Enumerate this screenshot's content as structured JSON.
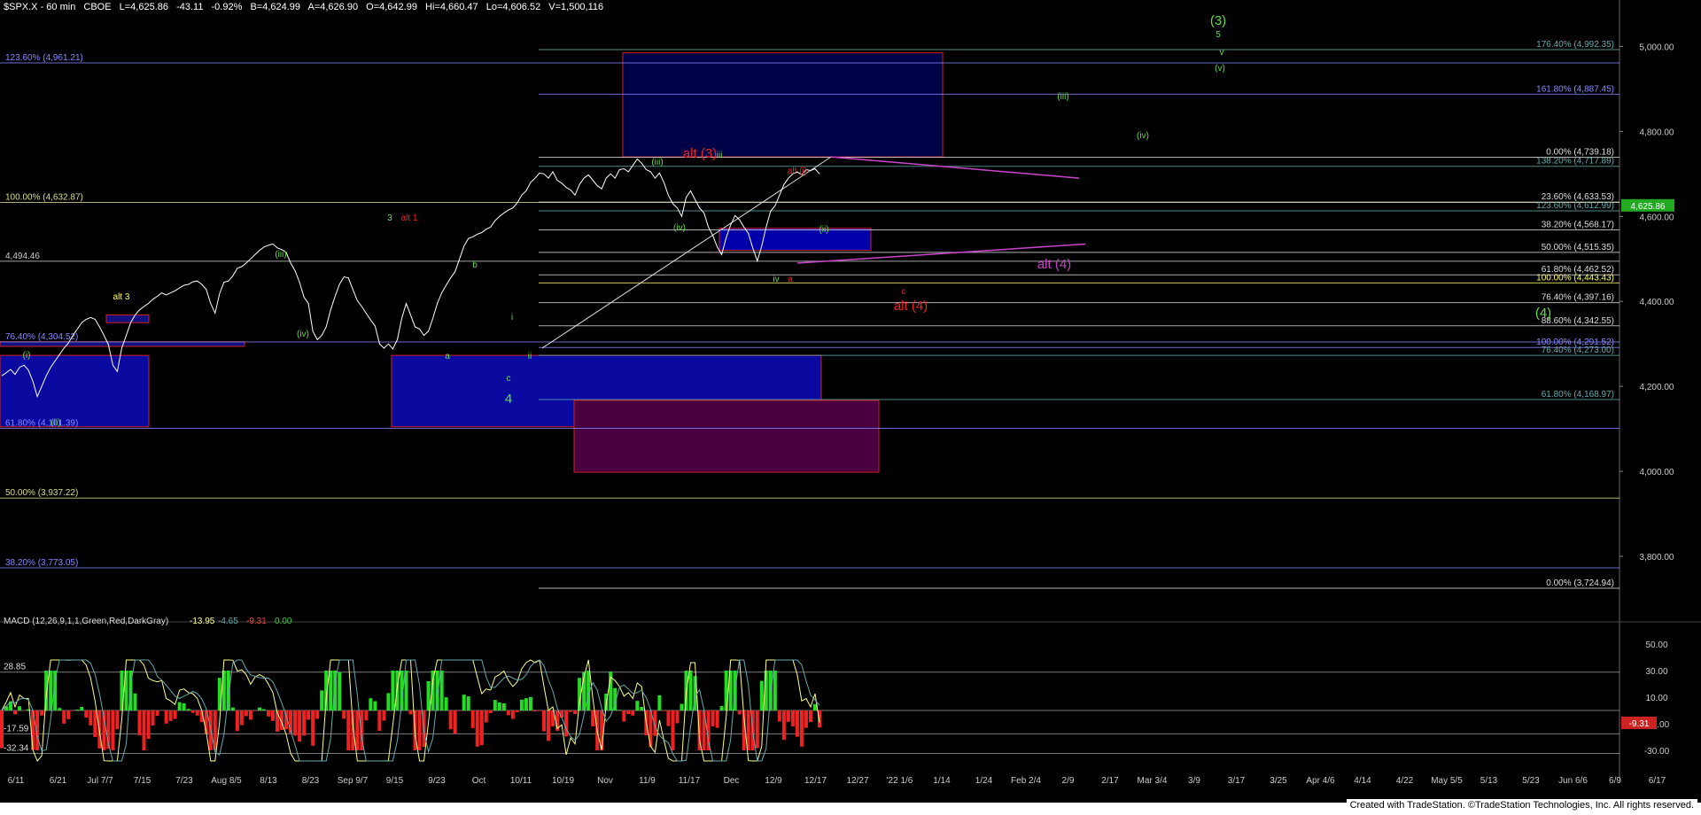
{
  "header": {
    "symbol": "$SPX.X - 60 min",
    "exchange": "CBOE",
    "last": "L=4,625.86",
    "change": "-43.11",
    "change_pct": "-0.92%",
    "bid": "B=4,624.99",
    "ask": "A=4,626.90",
    "open": "O=4,642.99",
    "high": "Hi=4,660.47",
    "low": "Lo=4,606.52",
    "volume": "V=1,500,116"
  },
  "credit": "Created with TradeStation. ©TradeStation Technologies, Inc. All rights reserved.",
  "colors": {
    "background": "#000000",
    "price": "#ffffff",
    "green_count": "#66dd44",
    "red_count": "#ee2222",
    "magenta_count": "#cc44cc",
    "blue_zone": "#0a0a80",
    "fib_line": "#b0b060"
  },
  "chart_data": [
    {
      "type": "line",
      "name": "price",
      "ylim": [
        3650,
        5080
      ],
      "y_ticks": [
        "5,000.00",
        "4,800.00",
        "4,600.00",
        "4,400.00",
        "4,200.00",
        "4,000.00",
        "3,800.00"
      ],
      "y_tick_values": [
        5000,
        4800,
        4600,
        4400,
        4200,
        4000,
        3800
      ],
      "x_ticks": [
        "6/11",
        "6/21",
        "Jul 7/7",
        "7/15",
        "7/23",
        "Aug 8/5",
        "8/13",
        "8/23",
        "Sep 9/7",
        "9/15",
        "9/23",
        "Oct",
        "10/11",
        "10/19",
        "Nov",
        "11/9",
        "11/17",
        "Dec",
        "12/9",
        "12/17",
        "12/27",
        "'22 1/6",
        "1/14",
        "1/24",
        "Feb 2/4",
        "2/9",
        "2/17",
        "Mar 3/4",
        "3/9",
        "3/17",
        "3/25",
        "Apr 4/6",
        "4/14",
        "4/22",
        "May 5/5",
        "5/13",
        "5/23",
        "Jun 6/6",
        "6/9",
        "6/17"
      ],
      "x": [
        0,
        5,
        10,
        15,
        20,
        25,
        30,
        35,
        40,
        45,
        50,
        55,
        60,
        65,
        70,
        75,
        80,
        85,
        90,
        95,
        100,
        105,
        110,
        115,
        120,
        125,
        130,
        135,
        140,
        145,
        150,
        155,
        160,
        165,
        170,
        175,
        180,
        185,
        190,
        195,
        200,
        205,
        210,
        215,
        220,
        225,
        230,
        235,
        240,
        245,
        250,
        255,
        260,
        265,
        270,
        275,
        280,
        285,
        290,
        295,
        300,
        305,
        310,
        315,
        320,
        325,
        330,
        335,
        340,
        345,
        350,
        355,
        360,
        365,
        370,
        375,
        380,
        385,
        390,
        395,
        400,
        405,
        410,
        415,
        420,
        425,
        430,
        435,
        440,
        445,
        450,
        455,
        460,
        465,
        470,
        475,
        480,
        485,
        490,
        495,
        500,
        505,
        510,
        515,
        520,
        525,
        530,
        535,
        540,
        545,
        550,
        555,
        560,
        565,
        570,
        575,
        580,
        585,
        590,
        595,
        600,
        605,
        610,
        615,
        620,
        625,
        630,
        635,
        640,
        645,
        650,
        655,
        660,
        665,
        670,
        675,
        680,
        685,
        690,
        695,
        700,
        705,
        710,
        715,
        720,
        725,
        730,
        735,
        740,
        745,
        750,
        755,
        760,
        765,
        770,
        775,
        780,
        785,
        790,
        795,
        800,
        805,
        810,
        815,
        820,
        825,
        830,
        835,
        840,
        845,
        850,
        855,
        860,
        865,
        870,
        875,
        880,
        885,
        890,
        895,
        900,
        905,
        910,
        915,
        920
      ],
      "y": [
        4225,
        4232,
        4240,
        4228,
        4245,
        4250,
        4238,
        4212,
        4176,
        4200,
        4225,
        4245,
        4260,
        4275,
        4290,
        4302,
        4320,
        4335,
        4350,
        4358,
        4362,
        4358,
        4340,
        4320,
        4298,
        4250,
        4235,
        4290,
        4320,
        4350,
        4368,
        4380,
        4388,
        4395,
        4405,
        4412,
        4420,
        4415,
        4420,
        4425,
        4432,
        4438,
        4440,
        4446,
        4448,
        4440,
        4428,
        4395,
        4372,
        4418,
        4445,
        4448,
        4460,
        4478,
        4482,
        4490,
        4500,
        4510,
        4520,
        4528,
        4532,
        4535,
        4526,
        4522,
        4515,
        4490,
        4472,
        4445,
        4410,
        4395,
        4330,
        4310,
        4320,
        4340,
        4380,
        4412,
        4440,
        4458,
        4455,
        4428,
        4402,
        4388,
        4372,
        4356,
        4342,
        4300,
        4290,
        4300,
        4288,
        4310,
        4360,
        4395,
        4368,
        4340,
        4335,
        4320,
        4330,
        4360,
        4395,
        4420,
        4438,
        4455,
        4470,
        4500,
        4530,
        4548,
        4552,
        4558,
        4562,
        4570,
        4575,
        4590,
        4600,
        4608,
        4615,
        4620,
        4632,
        4650,
        4660,
        4680,
        4690,
        4702,
        4700,
        4690,
        4705,
        4685,
        4678,
        4668,
        4662,
        4650,
        4675,
        4690,
        4698,
        4685,
        4672,
        4665,
        4690,
        4700,
        4690,
        4710,
        4712,
        4705,
        4720,
        4735,
        4725,
        4710,
        4705,
        4690,
        4702,
        4680,
        4650,
        4630,
        4620,
        4600,
        4645,
        4660,
        4640,
        4620,
        4608,
        4575,
        4555,
        4528,
        4510,
        4550,
        4580,
        4602,
        4592,
        4575,
        4560,
        4525,
        4495,
        4530,
        4575,
        4612,
        4625,
        4650,
        4675,
        4690,
        4700,
        4705,
        4698,
        4710,
        4708,
        4712,
        4700,
        4680,
        4662,
        4640,
        4626
      ]
    },
    {
      "type": "line",
      "name": "MACD",
      "title": "MACD (12,26,9,1,1,Green,Red,DarkGray)",
      "readouts": [
        "-13.95",
        "-4.65",
        "-9.31",
        "0.00"
      ],
      "ylim": [
        -40,
        60
      ],
      "y_ticks": [
        "50.00",
        "30.00",
        "10.00",
        "-10.00",
        "-30.00"
      ],
      "y_tick_values": [
        50,
        30,
        10,
        -10,
        -30
      ],
      "levels": [
        {
          "label": "28.85",
          "value": 28.85
        },
        {
          "label": "-17.59",
          "value": -17.59
        },
        {
          "label": "-32.34",
          "value": -32.34
        }
      ],
      "last_value_label": "-9.31"
    }
  ],
  "price_badge": "4,625.86",
  "fib_levels": [
    {
      "label": "123.60% (4,961.21)",
      "value": 4961.21,
      "side": "left",
      "color": "#8888ff"
    },
    {
      "label": "100.00% (4,632.87)",
      "value": 4632.87,
      "side": "left",
      "color": "#dddd88"
    },
    {
      "label": "4,494.46",
      "value": 4494.46,
      "side": "left",
      "color": "#cccccc"
    },
    {
      "label": "76.40% (4,304.52)",
      "value": 4304.52,
      "side": "left",
      "color": "#8888ff"
    },
    {
      "label": "61.80% (4,101.39)",
      "value": 4101.39,
      "side": "left",
      "color": "#8888ff"
    },
    {
      "label": "50.00% (3,937.22)",
      "value": 3937.22,
      "side": "left",
      "color": "#dddd88"
    },
    {
      "label": "38.20% (3,773.05)",
      "value": 3773.05,
      "side": "left",
      "color": "#8888ff"
    },
    {
      "label": "176.40% (4,992.35)",
      "value": 4992.35,
      "side": "right",
      "color": "#66aaaa"
    },
    {
      "label": "161.80% (4,887.45)",
      "value": 4887.45,
      "side": "right",
      "color": "#8888ff"
    },
    {
      "label": "0.00% (4,739.18)",
      "value": 4739.18,
      "side": "right",
      "color": "#dddddd"
    },
    {
      "label": "138.20% (4,717.89)",
      "value": 4717.89,
      "side": "right",
      "color": "#66aaaa"
    },
    {
      "label": "23.60% (4,633.53)",
      "value": 4633.53,
      "side": "right",
      "color": "#dddddd"
    },
    {
      "label": "123.60% (4,612.99)",
      "value": 4612.99,
      "side": "right",
      "color": "#66aaaa"
    },
    {
      "label": "38.20% (4,568.17)",
      "value": 4568.17,
      "side": "right",
      "color": "#dddddd"
    },
    {
      "label": "50.00% (4,515.35)",
      "value": 4515.35,
      "side": "right",
      "color": "#dddddd"
    },
    {
      "label": "61.80% (4,462.52)",
      "value": 4462.52,
      "side": "right",
      "color": "#dddddd"
    },
    {
      "label": "100.00% (4,443.43)",
      "value": 4443.43,
      "side": "right",
      "color": "#ffff66"
    },
    {
      "label": "76.40% (4,397.16)",
      "value": 4397.16,
      "side": "right",
      "color": "#dddddd"
    },
    {
      "label": "88.60% (4,342.55)",
      "value": 4342.55,
      "side": "right",
      "color": "#dddddd"
    },
    {
      "label": "100.00% (4,291.52)",
      "value": 4291.52,
      "side": "right",
      "color": "#8888ff"
    },
    {
      "label": "76.40% (4,273.00)",
      "value": 4273.0,
      "side": "right",
      "color": "#66aaaa"
    },
    {
      "label": "61.80% (4,168.97)",
      "value": 4168.97,
      "side": "right",
      "color": "#66aaaa"
    },
    {
      "label": "0.00% (3,724.94)",
      "value": 3724.94,
      "side": "right",
      "color": "#dddddd"
    }
  ],
  "annotations": [
    {
      "text": "(3)",
      "color": "#66dd44",
      "big": true
    },
    {
      "text": "5",
      "color": "#66dd44"
    },
    {
      "text": "v",
      "color": "#66dd44"
    },
    {
      "text": "(v)",
      "color": "#66dd44"
    },
    {
      "text": "(iii)",
      "color": "#66dd44"
    },
    {
      "text": "(iv)",
      "color": "#66dd44"
    },
    {
      "text": "alt (3)",
      "color": "#ee2222",
      "big": true
    },
    {
      "text": "iii",
      "color": "#66dd44"
    },
    {
      "text": "(iii)",
      "color": "#66dd44"
    },
    {
      "text": "alt (i)",
      "color": "#ee2222"
    },
    {
      "text": "(iv)",
      "color": "#66dd44"
    },
    {
      "text": "(ii)",
      "color": "#66dd44"
    },
    {
      "text": "alt (4)",
      "color": "#cc44cc",
      "big": true
    },
    {
      "text": "iv",
      "color": "#66dd44"
    },
    {
      "text": "a",
      "color": "#ee2222"
    },
    {
      "text": "c",
      "color": "#ee2222"
    },
    {
      "text": "alt (4)",
      "color": "#ee2222",
      "big": true
    },
    {
      "text": "(4)",
      "color": "#66dd44",
      "big": true
    },
    {
      "text": "3",
      "color": "#66dd44"
    },
    {
      "text": "alt 1",
      "color": "#ee2222"
    },
    {
      "text": "(iii)",
      "color": "#66dd44"
    },
    {
      "text": "b",
      "color": "#66dd44"
    },
    {
      "text": "alt 3",
      "color": "#ffff44"
    },
    {
      "text": "(iv)",
      "color": "#66dd44"
    },
    {
      "text": "(i)",
      "color": "#66dd44"
    },
    {
      "text": "(ii)",
      "color": "#66dd44"
    },
    {
      "text": "a",
      "color": "#66dd44"
    },
    {
      "text": "i",
      "color": "#66dd44"
    },
    {
      "text": "ii",
      "color": "#66dd44"
    },
    {
      "text": "c",
      "color": "#66dd44"
    },
    {
      "text": "4",
      "color": "#66dd44",
      "big": true
    }
  ]
}
